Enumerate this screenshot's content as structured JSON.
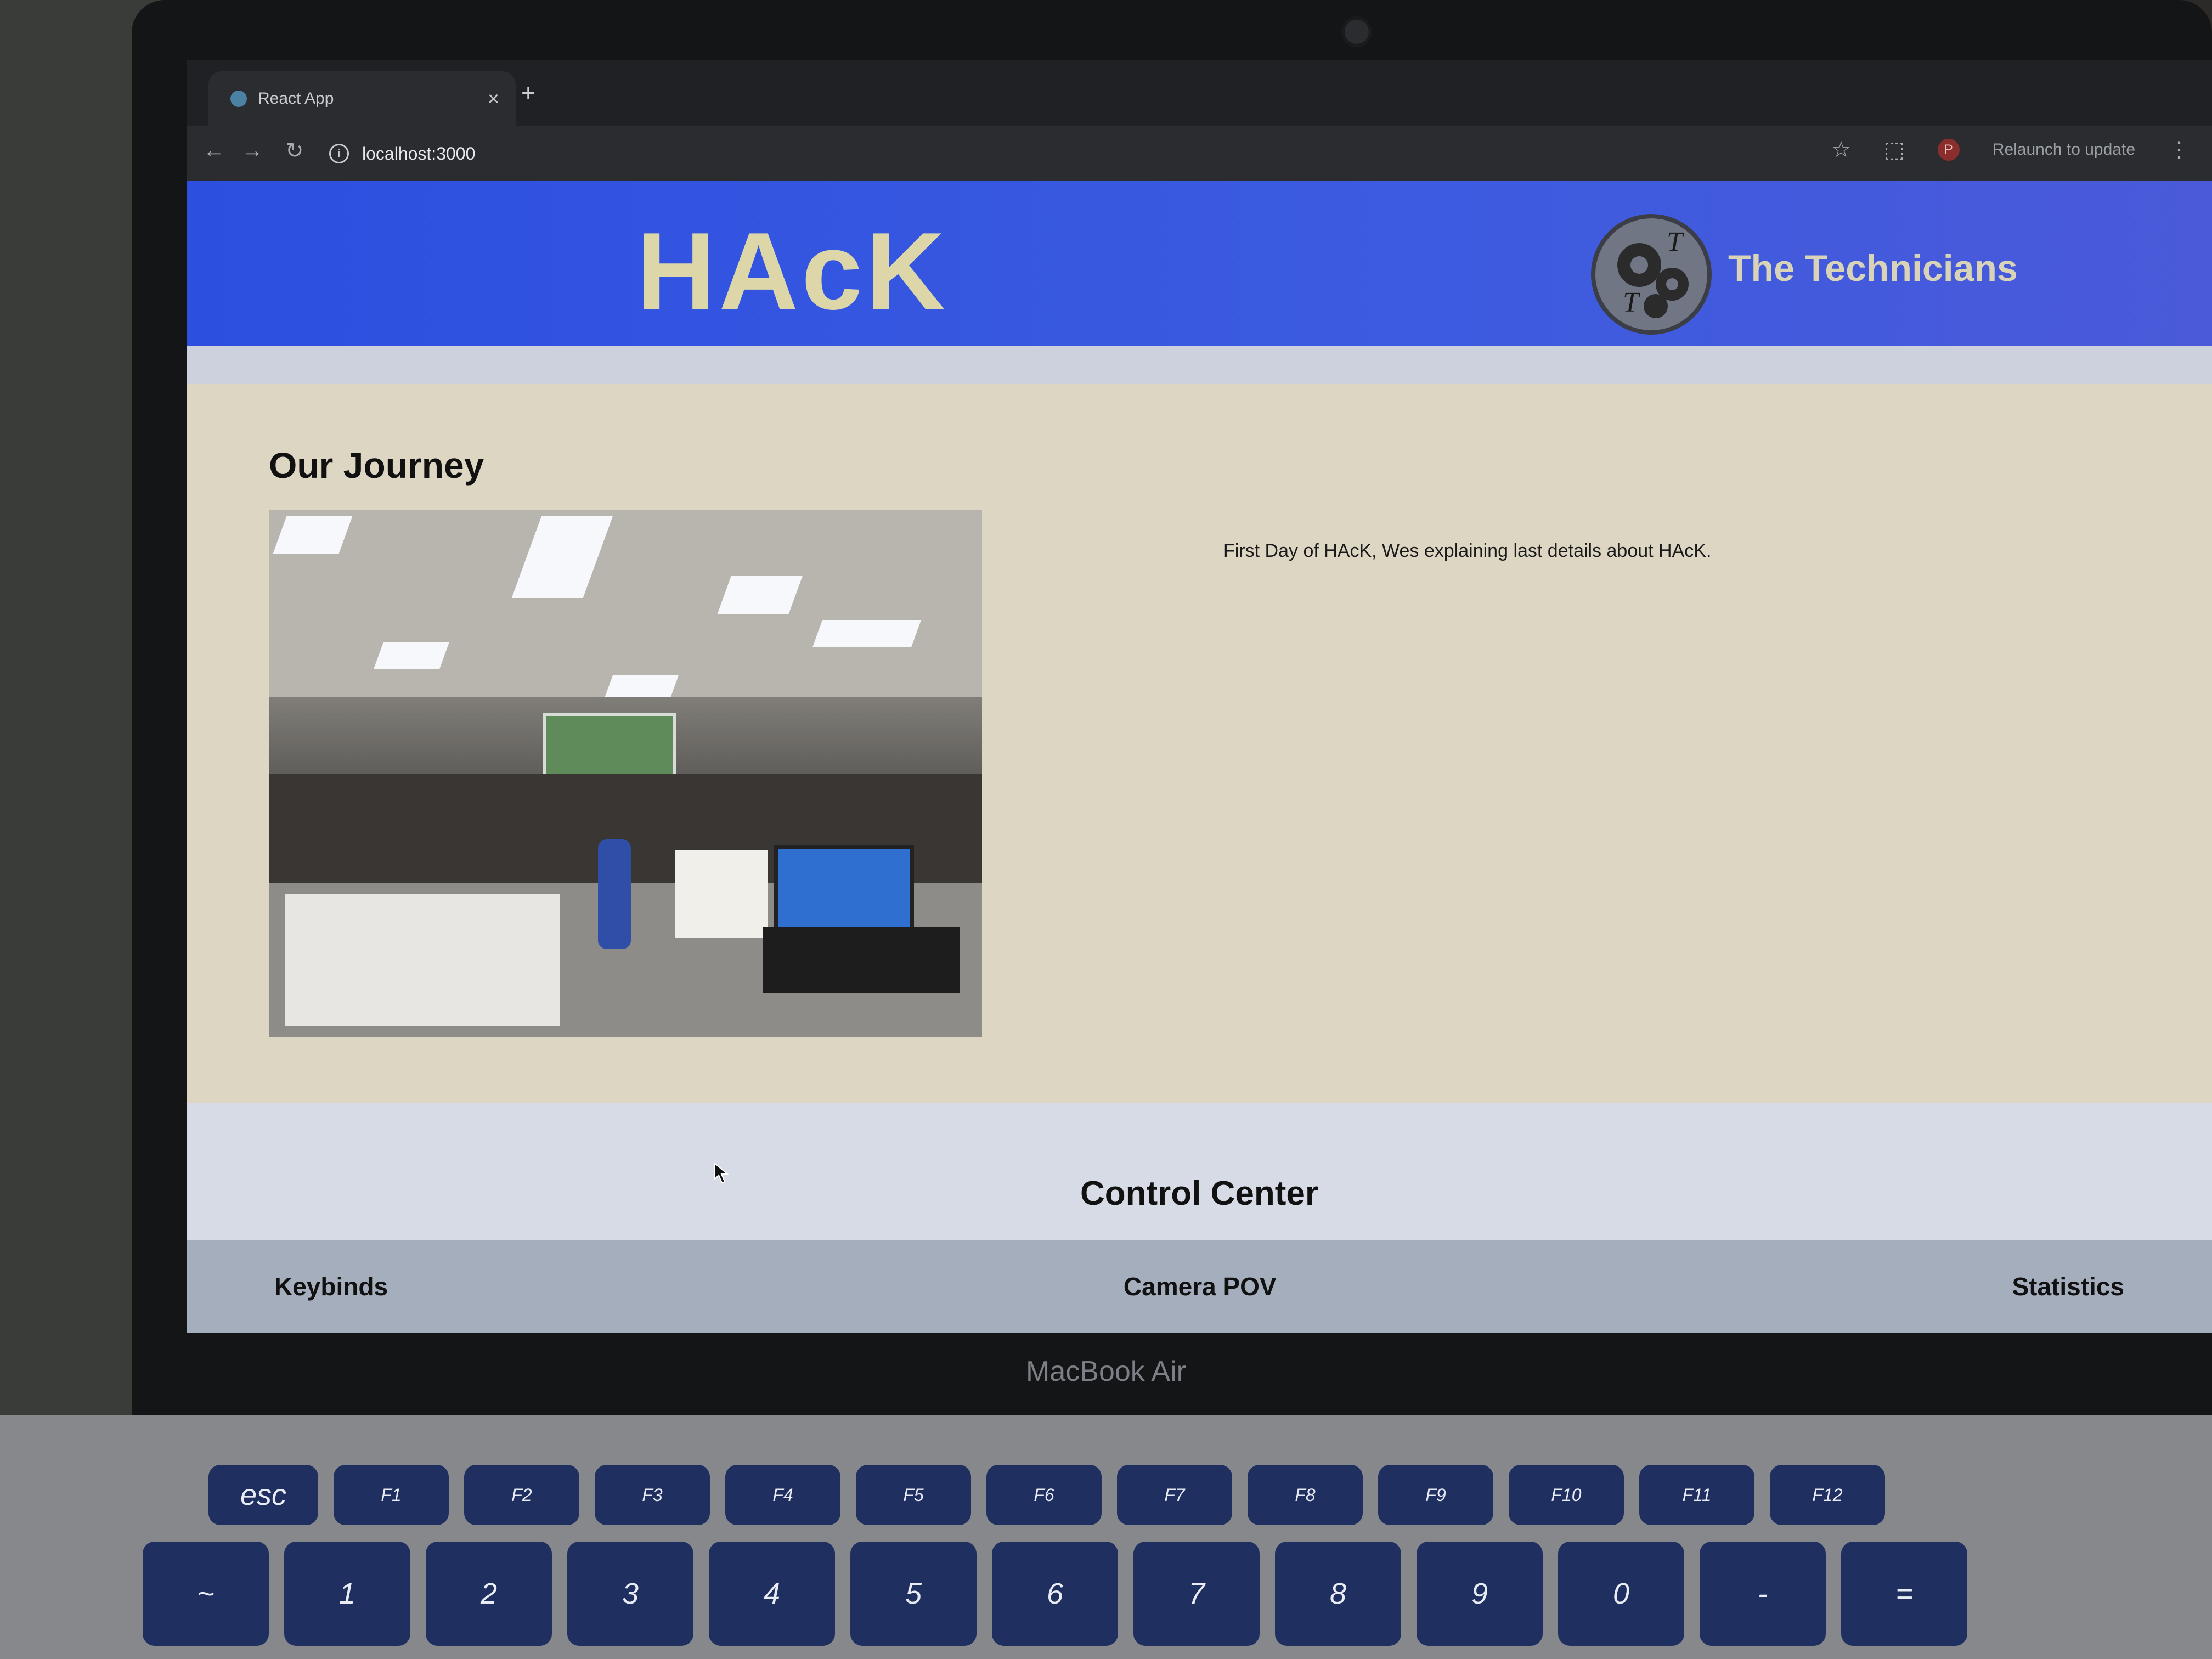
{
  "browser": {
    "tab_title": "React App",
    "tab_close": "×",
    "new_tab": "+",
    "back": "←",
    "forward": "→",
    "reload": "↻",
    "url": "localhost:3000",
    "star": "☆",
    "extensions": "⬚",
    "profile_initial": "P",
    "relaunch_label": "Relaunch to update",
    "menu": "⋮"
  },
  "site": {
    "brand": "HAcK",
    "team_name": "The Technicians"
  },
  "journey": {
    "title": "Our Journey",
    "caption": "First Day of HAcK, Wes explaining last details about HAcK."
  },
  "control_center": {
    "title": "Control Center",
    "tabs": [
      "Keybinds",
      "Camera POV",
      "Statistics"
    ]
  },
  "device": {
    "label": "MacBook Air",
    "keys": [
      "esc",
      "F1",
      "F2",
      "F3",
      "F4",
      "F5",
      "F6",
      "F7",
      "F8",
      "F9",
      "F10",
      "F11",
      "F12"
    ],
    "number_keys": [
      "~",
      "1",
      "2",
      "3",
      "4",
      "5",
      "6",
      "7",
      "8",
      "9",
      "0",
      "-",
      "="
    ]
  }
}
